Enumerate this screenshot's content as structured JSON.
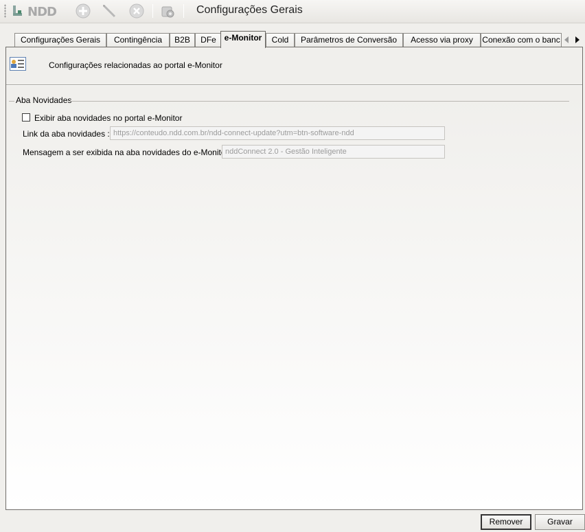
{
  "toolbar": {
    "brand": "NDD",
    "buttons": [
      {
        "name": "add-icon"
      },
      {
        "name": "edit-icon"
      },
      {
        "name": "delete-icon"
      },
      {
        "name": "settings-gear-icon"
      }
    ],
    "title": "Configurações Gerais"
  },
  "tabs": [
    {
      "label": "Configurações Gerais",
      "active": false
    },
    {
      "label": "Contingência",
      "active": false
    },
    {
      "label": "B2B",
      "active": false
    },
    {
      "label": "DFe",
      "active": false
    },
    {
      "label": "e-Monitor",
      "active": true
    },
    {
      "label": "Cold",
      "active": false
    },
    {
      "label": "Parâmetros de Conversão",
      "active": false
    },
    {
      "label": "Acesso via proxy",
      "active": false
    },
    {
      "label": "Conexão com o banc",
      "active": false
    }
  ],
  "header": {
    "description": "Configurações relacionadas ao portal e-Monitor"
  },
  "group": {
    "title": "Aba Novidades",
    "checkbox_label": "Exibir aba novidades no portal e-Monitor",
    "checkbox_checked": false,
    "link_label": "Link da aba novidades :",
    "link_value": "https://conteudo.ndd.com.br/ndd-connect-update?utm=btn-software-ndd",
    "message_label": "Mensagem a ser exibida na aba novidades do e-Monitor:",
    "message_value": "nddConnect 2.0 - Gestão Inteligente"
  },
  "actions": {
    "remove_label": "Remover",
    "save_label": "Gravar"
  }
}
